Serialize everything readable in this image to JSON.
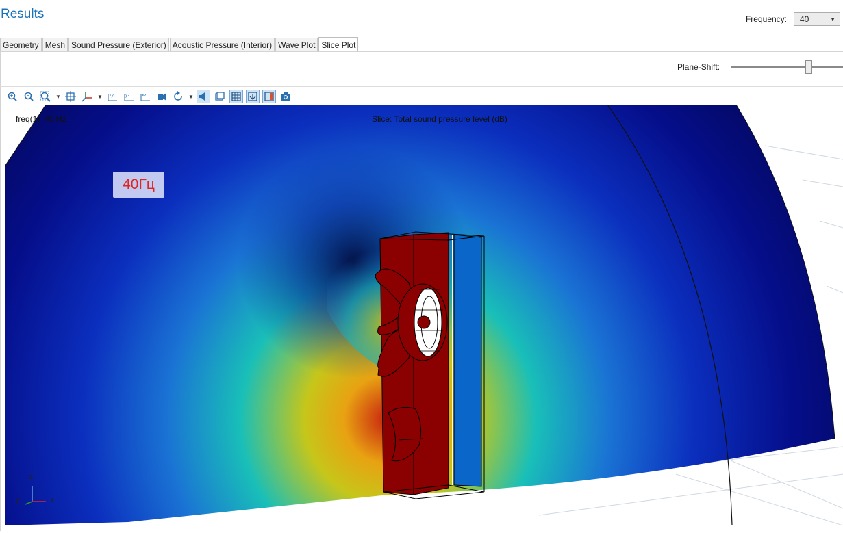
{
  "header": {
    "title": "Results"
  },
  "frequency": {
    "label": "Frequency:",
    "value": "40"
  },
  "tabs": [
    {
      "label": "Geometry",
      "active": false
    },
    {
      "label": "Mesh",
      "active": false
    },
    {
      "label": "Sound Pressure (Exterior)",
      "active": false
    },
    {
      "label": "Acoustic Pressure (Interior)",
      "active": false
    },
    {
      "label": "Wave Plot",
      "active": false
    },
    {
      "label": "Slice Plot",
      "active": true
    }
  ],
  "plane_shift": {
    "label": "Plane-Shift:",
    "value_fraction": 0.7
  },
  "toolbar": [
    {
      "icon": "zoom-in-icon",
      "on": false
    },
    {
      "icon": "zoom-out-icon",
      "on": false
    },
    {
      "icon": "zoom-box-icon",
      "on": false
    },
    {
      "icon": "zoom-extents-icon",
      "on": false
    },
    {
      "icon": "axes-orientation-icon",
      "on": false
    },
    {
      "icon": "view-xy-icon",
      "on": false
    },
    {
      "icon": "view-yz-icon",
      "on": false
    },
    {
      "icon": "view-xz-icon",
      "on": false
    },
    {
      "icon": "camera-view-icon",
      "on": false
    },
    {
      "icon": "rotate-icon",
      "on": false
    },
    {
      "icon": "speaker-icon",
      "on": true
    },
    {
      "icon": "window-icon",
      "on": false
    },
    {
      "icon": "grid-icon",
      "on": true
    },
    {
      "icon": "axis-toggle-icon",
      "on": true
    },
    {
      "icon": "color-legend-icon",
      "on": true
    },
    {
      "icon": "screenshot-icon",
      "on": false
    }
  ],
  "plot": {
    "freq_text": "freq(1)=40 Hz",
    "slice_text": "Slice: Total sound pressure level (dB)",
    "overlay_label": "40Гц",
    "axes": {
      "z": "z",
      "y": "y",
      "x": "x"
    },
    "colors": {
      "cold": "#0a0a8a",
      "mid": "#14b4c8",
      "warm": "#d4c00a",
      "hot": "#8b0000"
    }
  }
}
